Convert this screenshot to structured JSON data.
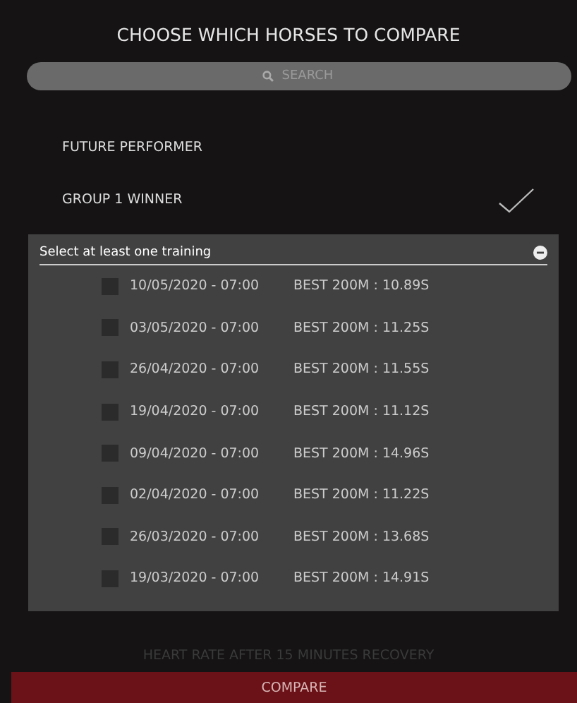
{
  "title": "CHOOSE WHICH HORSES TO COMPARE",
  "search": {
    "placeholder": "SEARCH"
  },
  "horses": [
    {
      "name": "FUTURE PERFORMER",
      "selected": false
    },
    {
      "name": "GROUP 1 WINNER",
      "selected": true
    }
  ],
  "training_panel": {
    "heading": "Select at least one training",
    "trainings": [
      {
        "date": "10/05/2020 - 07:00",
        "best": "BEST 200M : 10.89S",
        "checked": false
      },
      {
        "date": "03/05/2020 - 07:00",
        "best": "BEST 200M : 11.25S",
        "checked": false
      },
      {
        "date": "26/04/2020 - 07:00",
        "best": "BEST 200M : 11.55S",
        "checked": false
      },
      {
        "date": "19/04/2020 - 07:00",
        "best": "BEST 200M : 11.12S",
        "checked": false
      },
      {
        "date": "09/04/2020 - 07:00",
        "best": "BEST 200M : 14.96S",
        "checked": false
      },
      {
        "date": "02/04/2020 - 07:00",
        "best": "BEST 200M : 11.22S",
        "checked": false
      },
      {
        "date": "26/03/2020 - 07:00",
        "best": "BEST 200M : 13.68S",
        "checked": false
      },
      {
        "date": "19/03/2020 - 07:00",
        "best": "BEST 200M : 14.91S",
        "checked": false
      }
    ]
  },
  "background_label": "HEART RATE AFTER 15 MINUTES RECOVERY",
  "compare_button": "COMPARE"
}
